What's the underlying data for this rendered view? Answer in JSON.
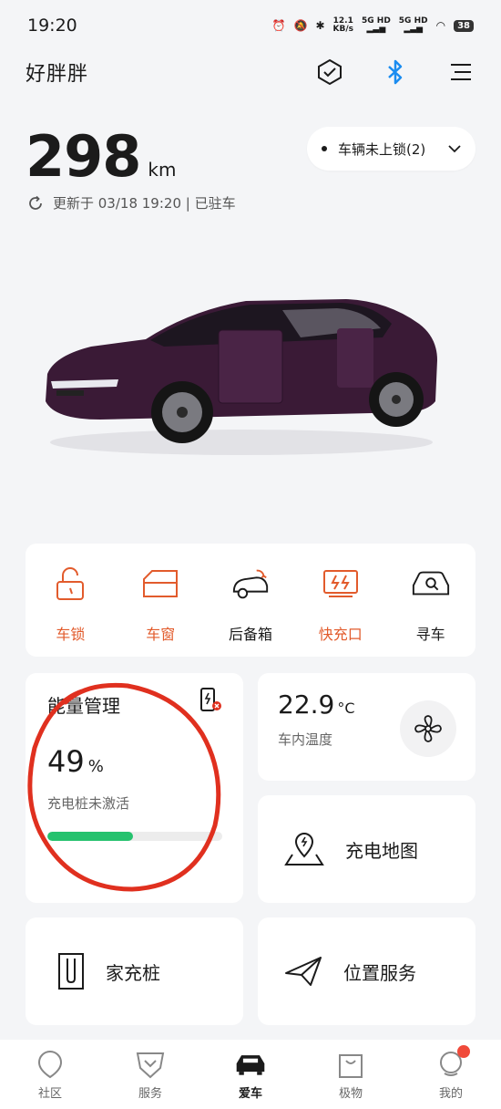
{
  "status_bar": {
    "time": "19:20",
    "net_speed": "12.1",
    "net_unit": "KB/s",
    "sim1": "5G HD",
    "sim2": "5G HD",
    "battery": "38"
  },
  "header": {
    "owner_name": "好胖胖",
    "icons": [
      "shield-check-icon",
      "bluetooth-icon",
      "menu-icon"
    ]
  },
  "vehicle": {
    "range_value": "298",
    "range_unit": "km",
    "lock_status": "车辆未上锁(2)",
    "update_text": "更新于 03/18 19:20 | 已驻车",
    "body_color": "#3a1a36"
  },
  "quick_controls": [
    {
      "label": "车锁",
      "icon": "lock-open-icon",
      "accent": true
    },
    {
      "label": "车窗",
      "icon": "window-icon",
      "accent": true
    },
    {
      "label": "后备箱",
      "icon": "trunk-icon",
      "accent": false
    },
    {
      "label": "快充口",
      "icon": "fast-charge-port-icon",
      "accent": true
    },
    {
      "label": "寻车",
      "icon": "find-car-icon",
      "accent": false
    }
  ],
  "energy": {
    "title": "能量管理",
    "percent": "49",
    "percent_unit": "%",
    "level_fraction": 0.49,
    "charger_status": "充电桩未激活"
  },
  "climate": {
    "temperature": "22.9",
    "temperature_unit": "°C",
    "label": "车内温度"
  },
  "features": {
    "charge_map": "充电地图",
    "home_charger": "家充桩",
    "location_service": "位置服务"
  },
  "tabs": [
    {
      "label": "社区",
      "icon": "community-icon",
      "active": false
    },
    {
      "label": "服务",
      "icon": "service-icon",
      "active": false
    },
    {
      "label": "爱车",
      "icon": "car-icon",
      "active": true
    },
    {
      "label": "极物",
      "icon": "shop-bag-icon",
      "active": false
    },
    {
      "label": "我的",
      "icon": "profile-icon",
      "active": false
    }
  ],
  "colors": {
    "accent_orange": "#e25b2c",
    "progress_green": "#25c26e",
    "bluetooth_blue": "#1a8cf0",
    "annotation_red": "#e0301f"
  }
}
